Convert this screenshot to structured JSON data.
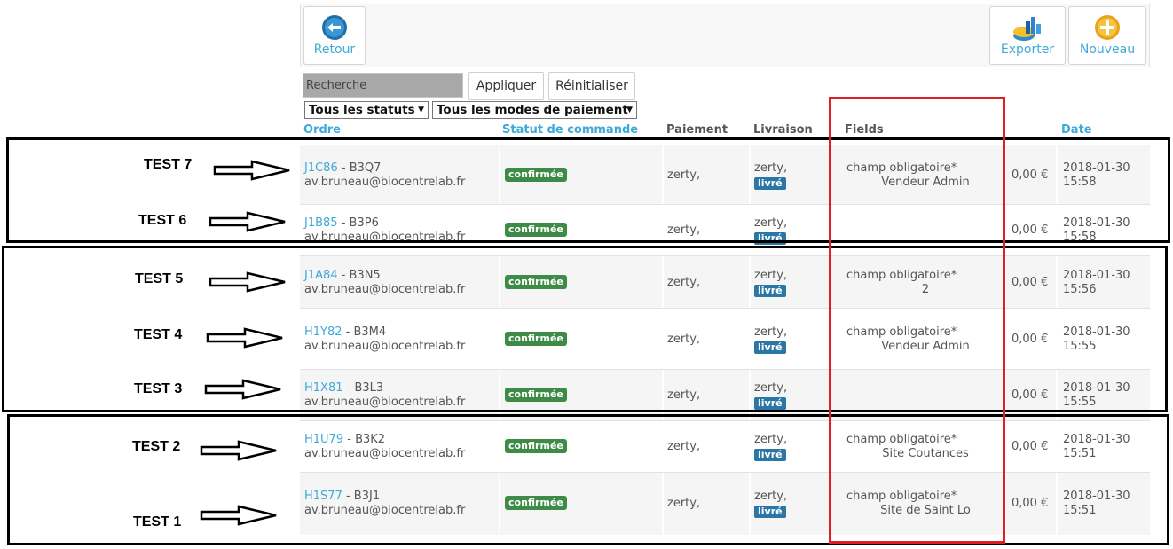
{
  "toolbar": {
    "back_label": "Retour",
    "export_label": "Exporter",
    "new_label": "Nouveau"
  },
  "filters": {
    "search_placeholder": "Recherche",
    "apply_label": "Appliquer",
    "reset_label": "Réinitialiser",
    "status_select": "Tous les statuts",
    "payment_select": "Tous les modes de paiement"
  },
  "columns": {
    "order": "Ordre",
    "status": "Statut de commande",
    "payment": "Paiement",
    "delivery": "Livraison",
    "fields": "Fields",
    "date": "Date"
  },
  "rows": [
    {
      "order_id": "J1C86",
      "ref": " - B3Q7",
      "email": "av.bruneau@biocentrelab.fr",
      "status": "confirmée",
      "payment": "zerty,",
      "delivery": "zerty,",
      "delivery_badge": "livré",
      "field_label": "champ obligatoire*",
      "field_value": "Vendeur Admin",
      "amount": "0,00 €",
      "date": "2018-01-30",
      "time": "15:58"
    },
    {
      "order_id": "J1B85",
      "ref": " - B3P6",
      "email": "av.bruneau@biocentrelab.fr",
      "status": "confirmée",
      "payment": "zerty,",
      "delivery": "zerty,",
      "delivery_badge": "livré",
      "field_label": "",
      "field_value": "",
      "amount": "0,00 €",
      "date": "2018-01-30",
      "time": "15:58"
    },
    {
      "order_id": "J1A84",
      "ref": " - B3N5",
      "email": "av.bruneau@biocentrelab.fr",
      "status": "confirmée",
      "payment": "zerty,",
      "delivery": "zerty,",
      "delivery_badge": "livré",
      "field_label": "champ obligatoire*",
      "field_value": "2",
      "amount": "0,00 €",
      "date": "2018-01-30",
      "time": "15:56"
    },
    {
      "order_id": "H1Y82",
      "ref": " - B3M4",
      "email": "av.bruneau@biocentrelab.fr",
      "status": "confirmée",
      "payment": "zerty,",
      "delivery": "zerty,",
      "delivery_badge": "livré",
      "field_label": "champ obligatoire*",
      "field_value": "Vendeur Admin",
      "amount": "0,00 €",
      "date": "2018-01-30",
      "time": "15:55"
    },
    {
      "order_id": "H1X81",
      "ref": " - B3L3",
      "email": "av.bruneau@biocentrelab.fr",
      "status": "confirmée",
      "payment": "zerty,",
      "delivery": "zerty,",
      "delivery_badge": "livré",
      "field_label": "",
      "field_value": "",
      "amount": "0,00 €",
      "date": "2018-01-30",
      "time": "15:55"
    },
    {
      "order_id": "H1U79",
      "ref": " - B3K2",
      "email": "av.bruneau@biocentrelab.fr",
      "status": "confirmée",
      "payment": "zerty,",
      "delivery": "zerty,",
      "delivery_badge": "livré",
      "field_label": "champ obligatoire*",
      "field_value": "Site Coutances",
      "amount": "0,00 €",
      "date": "2018-01-30",
      "time": "15:51"
    },
    {
      "order_id": "H1S77",
      "ref": " - B3J1",
      "email": "av.bruneau@biocentrelab.fr",
      "status": "confirmée",
      "payment": "zerty,",
      "delivery": "zerty,",
      "delivery_badge": "livré",
      "field_label": "champ obligatoire*",
      "field_value": "Site de Saint Lo",
      "amount": "0,00 €",
      "date": "2018-01-30",
      "time": "15:51"
    }
  ],
  "annotations": {
    "tests": [
      "TEST 7",
      "TEST 6",
      "TEST 5",
      "TEST 4",
      "TEST 3",
      "TEST 2",
      "TEST 1"
    ],
    "box_color": "#000000",
    "highlight_color": "#e01e25"
  }
}
